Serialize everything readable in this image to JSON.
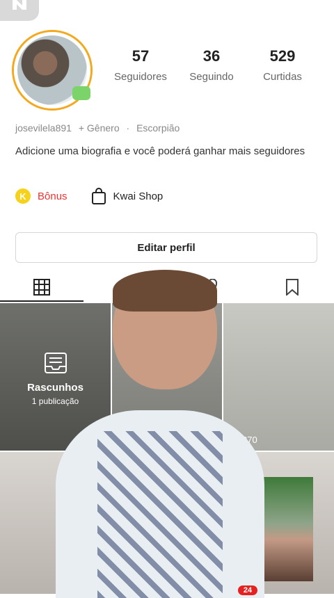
{
  "stats": [
    {
      "value": "57",
      "label": "Seguidores"
    },
    {
      "value": "36",
      "label": "Seguindo"
    },
    {
      "value": "529",
      "label": "Curtidas"
    }
  ],
  "profile": {
    "username": "josevilela891",
    "gender": "+ Gênero",
    "separator": "·",
    "sign": "Escorpião",
    "bio": "Adicione uma biografia e você poderá ganhar mais seguidores"
  },
  "actions": {
    "bonus_label": "Bônus",
    "coin_letter": "K",
    "shop_label": "Kwai Shop",
    "edit_label": "Editar perfil"
  },
  "tabs": [
    {
      "name": "grid",
      "icon": "grid-icon"
    },
    {
      "name": "private",
      "icon": "lock-icon"
    },
    {
      "name": "likes",
      "icon": "heart-icon"
    },
    {
      "name": "saved",
      "icon": "bookmark-icon"
    }
  ],
  "grid": {
    "drafts_title": "Rascunhos",
    "drafts_count": "1 publicação",
    "views": "270"
  },
  "bottom_nav": {
    "badge": "24"
  },
  "colors": {
    "accent_red": "#e33333",
    "coin_yellow": "#f6d21a",
    "avatar_ring": "#f4a81d"
  }
}
